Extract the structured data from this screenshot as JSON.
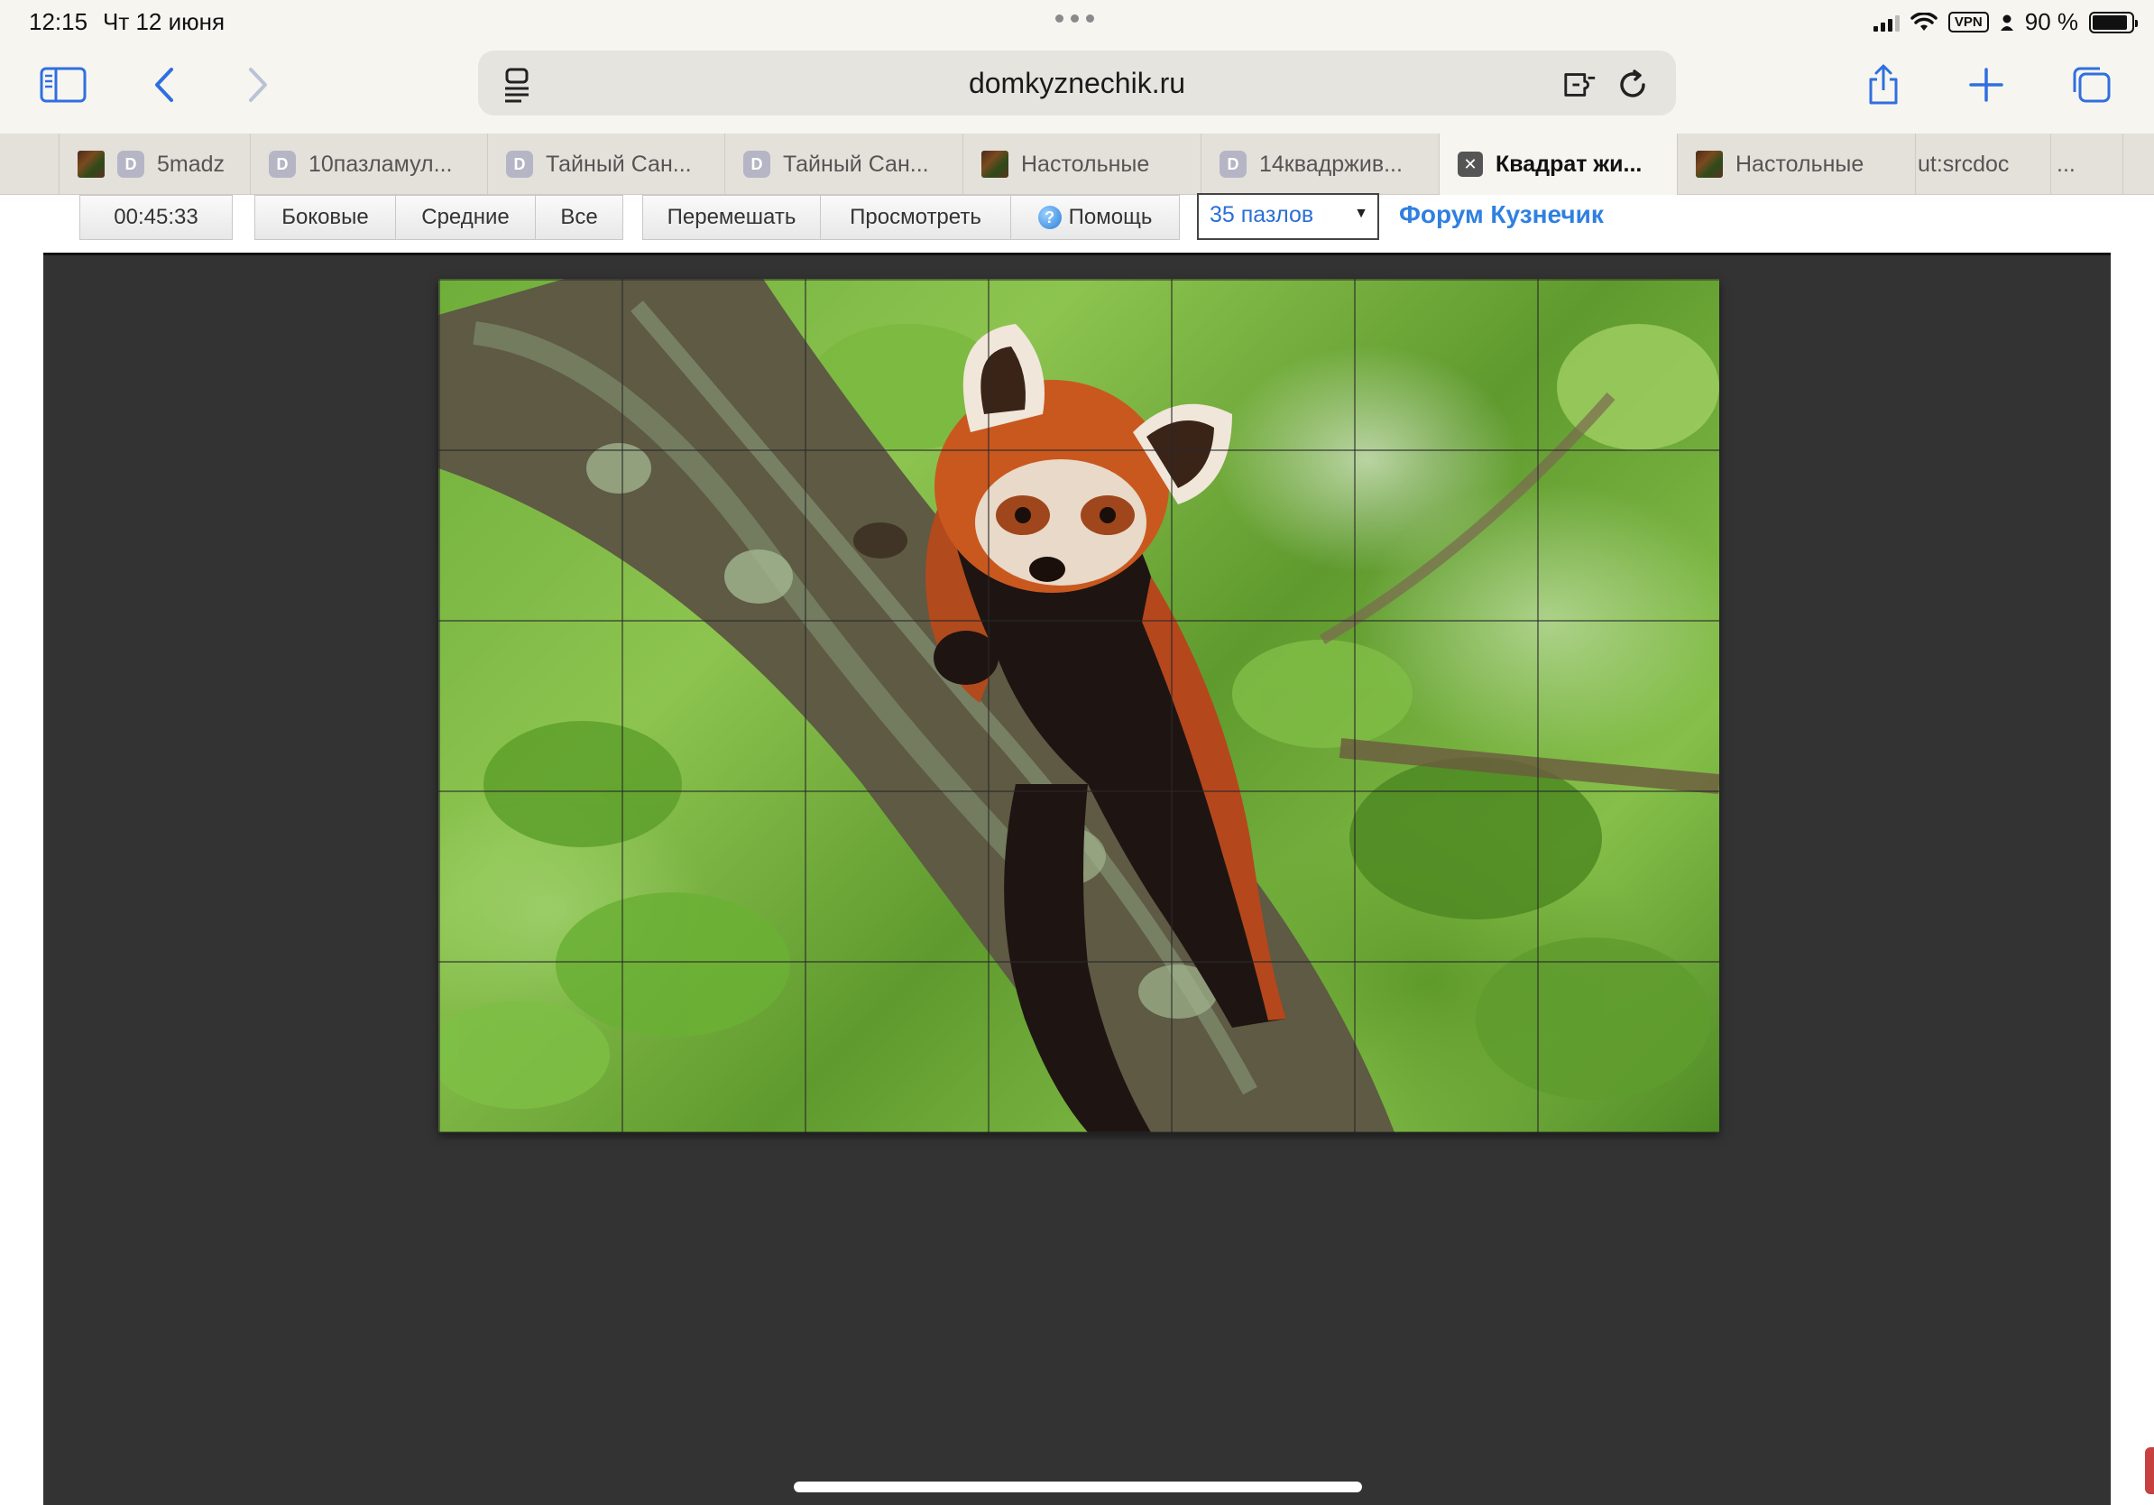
{
  "status_bar": {
    "time": "12:15",
    "date": "Чт 12 июня",
    "vpn": "VPN",
    "battery": "90 %",
    "battery_level": 0.9
  },
  "toolbar": {
    "url": "domkyznechik.ru",
    "icons": [
      "sidebar-icon",
      "back-icon",
      "forward-icon",
      "reader-icon",
      "extensions-icon",
      "reload-icon",
      "share-icon",
      "new-tab-icon",
      "tabs-overview-icon"
    ],
    "accent_color": "#2f6fe0"
  },
  "tabs": [
    {
      "label": "5madz",
      "favicon": "image",
      "active": false
    },
    {
      "label": "10пазламул...",
      "favicon": "D",
      "active": false
    },
    {
      "label": "Тайный Сан...",
      "favicon": "D",
      "active": false
    },
    {
      "label": "Тайный Сан...",
      "favicon": "D",
      "active": false
    },
    {
      "label": "Настольные",
      "favicon": "image",
      "active": false
    },
    {
      "label": "14квадржив...",
      "favicon": "D",
      "active": false
    },
    {
      "label": "Квадрат жи...",
      "favicon": "close",
      "active": true
    },
    {
      "label": "Настольные",
      "favicon": "image",
      "active": false
    },
    {
      "label": "ut:srcdoc",
      "favicon": "none",
      "active": false
    },
    {
      "label": "...",
      "favicon": "none",
      "active": false
    }
  ],
  "controls": {
    "timer": "00:45:33",
    "edges": "Боковые",
    "middle": "Средние",
    "all": "Все",
    "shuffle": "Перемешать",
    "preview": "Просмотреть",
    "help": "Помощь",
    "help_icon": "?",
    "pieces_select": "35 пазлов",
    "forum_link": "Форум Кузнечик"
  },
  "puzzle": {
    "columns": 7,
    "rows": 5,
    "image_subject": "red-panda-on-tree"
  }
}
